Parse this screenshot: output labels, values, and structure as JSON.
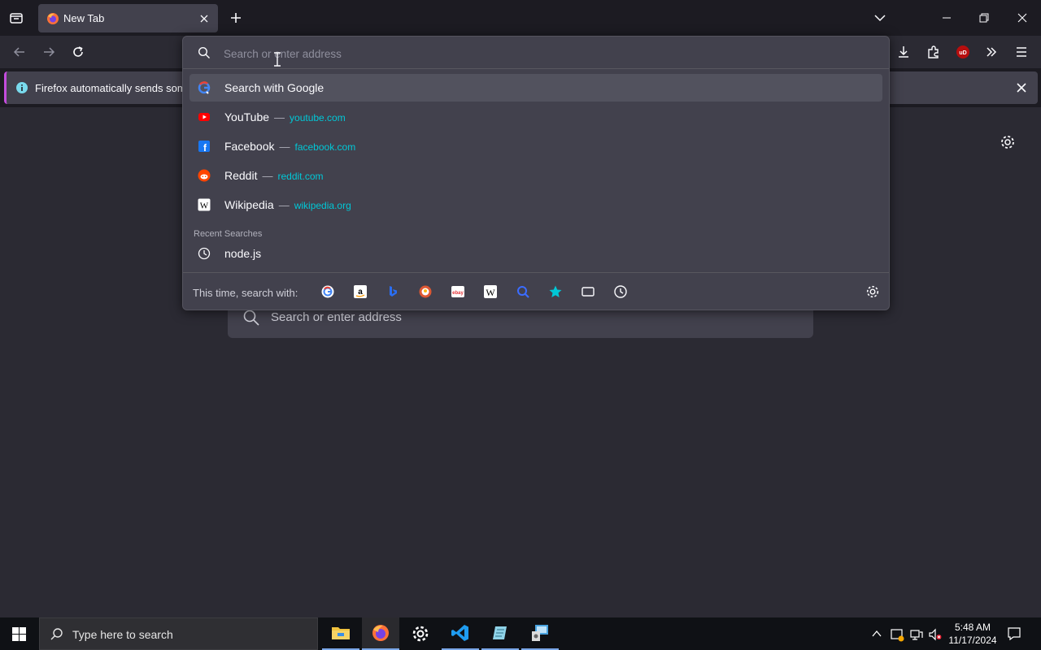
{
  "tab": {
    "title": "New Tab"
  },
  "notice": {
    "text": "Firefox automatically sends some d"
  },
  "urlbar": {
    "placeholder": "Search or enter address",
    "suggestions": [
      {
        "title": "Search with Google",
        "url": "",
        "icon": "google-icon"
      },
      {
        "title": "YouTube",
        "sep": "—",
        "url": "youtube.com",
        "icon": "youtube-icon"
      },
      {
        "title": "Facebook",
        "sep": "—",
        "url": "facebook.com",
        "icon": "facebook-icon"
      },
      {
        "title": "Reddit",
        "sep": "—",
        "url": "reddit.com",
        "icon": "reddit-icon"
      },
      {
        "title": "Wikipedia",
        "sep": "—",
        "url": "wikipedia.org",
        "icon": "wikipedia-icon"
      }
    ],
    "recent_label": "Recent Searches",
    "recent": [
      {
        "title": "node.js",
        "icon": "history-icon"
      }
    ],
    "footer_label": "This time, search with:",
    "engines": [
      "google-icon",
      "amazon-icon",
      "bing-icon",
      "duckduckgo-icon",
      "ebay-icon",
      "wikipedia-icon",
      "search-plus-icon",
      "bookmarks-icon",
      "tabs-icon",
      "history-icon"
    ]
  },
  "content": {
    "search_placeholder": "Search or enter address"
  },
  "taskbar": {
    "search_placeholder": "Type here to search",
    "time": "5:48 AM",
    "date": "11/17/2024"
  },
  "colors": {
    "accent": "#00c8d7",
    "notice_border": "#c44cdd",
    "panel": "#42414d"
  }
}
